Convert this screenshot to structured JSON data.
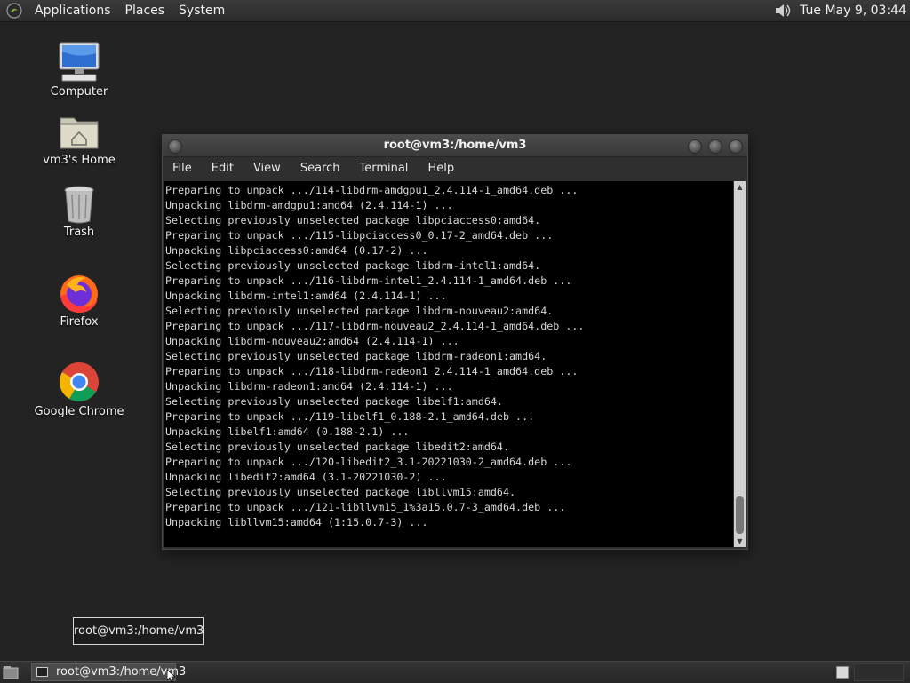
{
  "top_panel": {
    "menus": [
      "Applications",
      "Places",
      "System"
    ],
    "clock": "Tue May  9, 03:44",
    "icons": {
      "logo": "gnome-foot-icon",
      "volume": "volume-icon"
    }
  },
  "desktop": {
    "icons": [
      {
        "label": "Computer",
        "icon": "computer-icon"
      },
      {
        "label": "vm3's Home",
        "icon": "home-folder-icon"
      },
      {
        "label": "Trash",
        "icon": "trash-icon"
      },
      {
        "label": "Firefox",
        "icon": "firefox-icon"
      },
      {
        "label": "Google Chrome",
        "icon": "chrome-icon"
      }
    ]
  },
  "terminal": {
    "title": "root@vm3:/home/vm3",
    "menu": [
      "File",
      "Edit",
      "View",
      "Search",
      "Terminal",
      "Help"
    ],
    "lines": [
      "Preparing to unpack .../114-libdrm-amdgpu1_2.4.114-1_amd64.deb ...",
      "Unpacking libdrm-amdgpu1:amd64 (2.4.114-1) ...",
      "Selecting previously unselected package libpciaccess0:amd64.",
      "Preparing to unpack .../115-libpciaccess0_0.17-2_amd64.deb ...",
      "Unpacking libpciaccess0:amd64 (0.17-2) ...",
      "Selecting previously unselected package libdrm-intel1:amd64.",
      "Preparing to unpack .../116-libdrm-intel1_2.4.114-1_amd64.deb ...",
      "Unpacking libdrm-intel1:amd64 (2.4.114-1) ...",
      "Selecting previously unselected package libdrm-nouveau2:amd64.",
      "Preparing to unpack .../117-libdrm-nouveau2_2.4.114-1_amd64.deb ...",
      "Unpacking libdrm-nouveau2:amd64 (2.4.114-1) ...",
      "Selecting previously unselected package libdrm-radeon1:amd64.",
      "Preparing to unpack .../118-libdrm-radeon1_2.4.114-1_amd64.deb ...",
      "Unpacking libdrm-radeon1:amd64 (2.4.114-1) ...",
      "Selecting previously unselected package libelf1:amd64.",
      "Preparing to unpack .../119-libelf1_0.188-2.1_amd64.deb ...",
      "Unpacking libelf1:amd64 (0.188-2.1) ...",
      "Selecting previously unselected package libedit2:amd64.",
      "Preparing to unpack .../120-libedit2_3.1-20221030-2_amd64.deb ...",
      "Unpacking libedit2:amd64 (3.1-20221030-2) ...",
      "Selecting previously unselected package libllvm15:amd64.",
      "Preparing to unpack .../121-libllvm15_1%3a15.0.7-3_amd64.deb ...",
      "Unpacking libllvm15:amd64 (1:15.0.7-3) ..."
    ]
  },
  "tooltip": {
    "text": "root@vm3:/home/vm3"
  },
  "taskbar": {
    "task_label": "root@vm3:/home/vm3",
    "icons": {
      "show_desktop": "show-desktop-icon",
      "task": "terminal-icon",
      "workspace": "workspace-switcher-icon"
    }
  }
}
